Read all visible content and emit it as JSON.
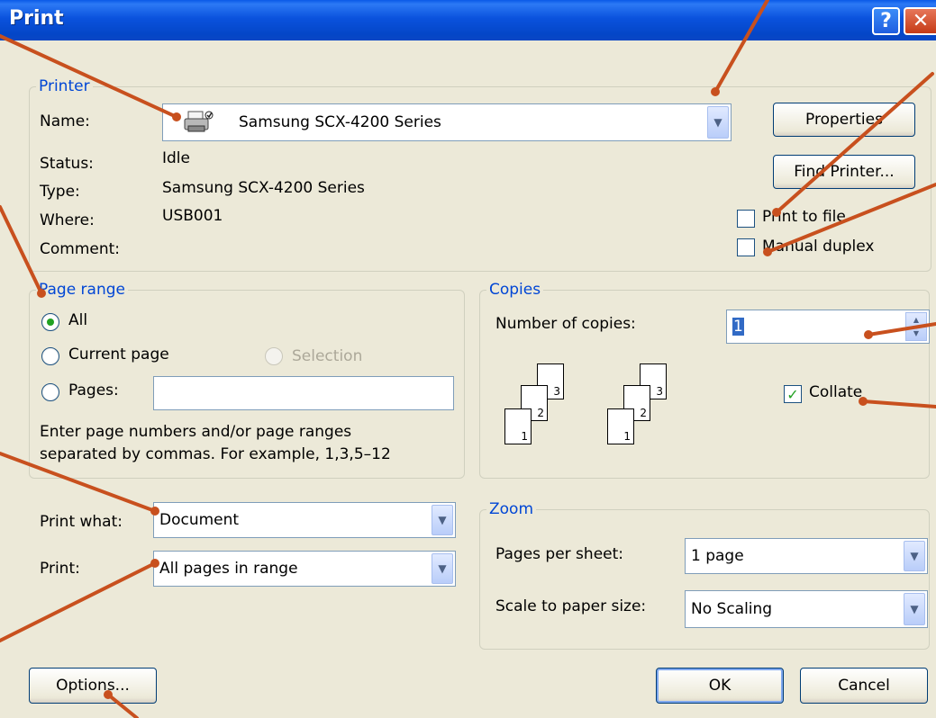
{
  "window": {
    "title": "Print",
    "help_glyph": "?",
    "close_glyph": "✕"
  },
  "printer": {
    "legend": "Printer",
    "name_label": "Name:",
    "name_value": "Samsung SCX-4200 Series",
    "status_label": "Status:",
    "status_value": "Idle",
    "type_label": "Type:",
    "type_value": "Samsung SCX-4200 Series",
    "where_label": "Where:",
    "where_value": "USB001",
    "comment_label": "Comment:",
    "properties_button": "Properties",
    "find_printer_button": "Find Printer...",
    "print_to_file_label": "Print to file",
    "print_to_file_checked": false,
    "manual_duplex_label": "Manual duplex",
    "manual_duplex_checked": false
  },
  "page_range": {
    "legend": "Page range",
    "all_label": "All",
    "current_page_label": "Current page",
    "selection_label": "Selection",
    "pages_label": "Pages:",
    "pages_value": "",
    "selected": "All",
    "hint_line1": "Enter page numbers and/or page ranges",
    "hint_line2": "separated by commas.  For example, 1,3,5–12"
  },
  "copies": {
    "legend": "Copies",
    "number_label": "Number of copies:",
    "number_value": "1",
    "collate_label": "Collate",
    "collate_checked": true,
    "collate_glyph": "✓",
    "stack_numbers": [
      "1",
      "2",
      "3"
    ]
  },
  "print_what": {
    "label": "Print what:",
    "value": "Document"
  },
  "print": {
    "label": "Print:",
    "value": "All pages in range"
  },
  "zoom": {
    "legend": "Zoom",
    "pages_per_sheet_label": "Pages per sheet:",
    "pages_per_sheet_value": "1 page",
    "scale_label": "Scale to paper size:",
    "scale_value": "No Scaling"
  },
  "buttons": {
    "options": "Options...",
    "ok": "OK",
    "cancel": "Cancel"
  },
  "colors": {
    "titlebar": "#0a52dd",
    "dialog_bg": "#ece9d8",
    "group_legend": "#0046d5",
    "callout_lines": "#c8501e"
  },
  "icons": {
    "printer": "printer-icon",
    "dropdown": "chevron-down-icon",
    "spinner": "spinner-arrows-icon"
  }
}
